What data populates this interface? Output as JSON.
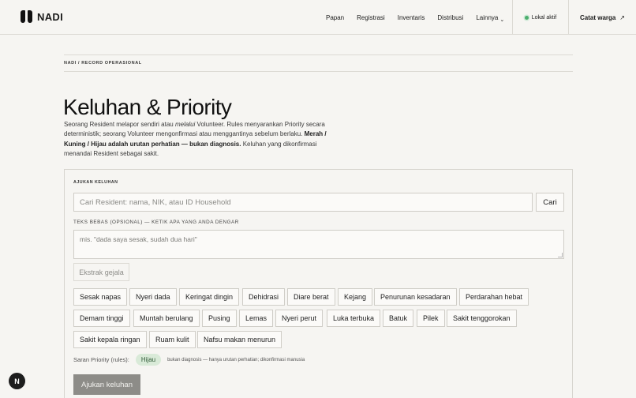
{
  "brand": {
    "name": "NADI"
  },
  "nav": {
    "items": [
      "Papan",
      "Registrasi",
      "Inventaris",
      "Distribusi",
      "Lainnya"
    ],
    "more_chevron": "⌄"
  },
  "status": {
    "label": "Lokal aktif",
    "color": "#4cae6e"
  },
  "cta": {
    "label": "Catat warga",
    "icon": "arrow-up-right-icon",
    "glyph": "↗"
  },
  "breadcrumb": "NADI / RECORD OPERASIONAL",
  "page": {
    "title": "Keluhan & Priority",
    "desc_1": "Seorang Resident melapor sendiri atau ",
    "desc_em": "melalui",
    "desc_2": " Volunteer. Rules menyarankan Priority secara deterministik; seorang Volunteer mengonfirmasi atau menggantinya sebelum berlaku. ",
    "desc_bold": "Merah / Kuning / Hijau adalah urutan perhatian — bukan diagnosis.",
    "desc_3": " Keluhan yang dikonfirmasi menandai Resident sebagai sakit."
  },
  "form": {
    "section_label": "AJUKAN KELUHAN",
    "search_placeholder": "Cari Resident: nama, NIK, atau ID Household",
    "search_button": "Cari",
    "free_text_label": "TEKS BEBAS (OPSIONAL) — KETIK APA YANG ANDA DENGAR",
    "free_text_placeholder": "mis. \"dada saya sesak, sudah dua hari\"",
    "extract_button": "Ekstrak gejala",
    "symptoms": [
      "Sesak napas",
      "Nyeri dada",
      "Keringat dingin",
      "Dehidrasi",
      "Diare berat",
      "Kejang",
      "Penurunan kesadaran",
      "Perdarahan hebat",
      "Demam tinggi",
      "Muntah berulang",
      "Pusing",
      "Lemas",
      "Nyeri perut",
      "Luka terbuka",
      "Batuk",
      "Pilek",
      "Sakit tenggorokan",
      "Sakit kepala ringan",
      "Ruam kulit",
      "Nafsu makan menurun"
    ],
    "priority_label": "Saran Priority (rules):",
    "priority_value": "Hijau",
    "priority_color": "#d9ead8",
    "priority_note": "bukan diagnosis — hanya urutan perhatian; dikonfirmasi manusia",
    "submit_button": "Ajukan keluhan"
  },
  "fab": {
    "label": "N",
    "icon": "nadi-n-icon"
  }
}
